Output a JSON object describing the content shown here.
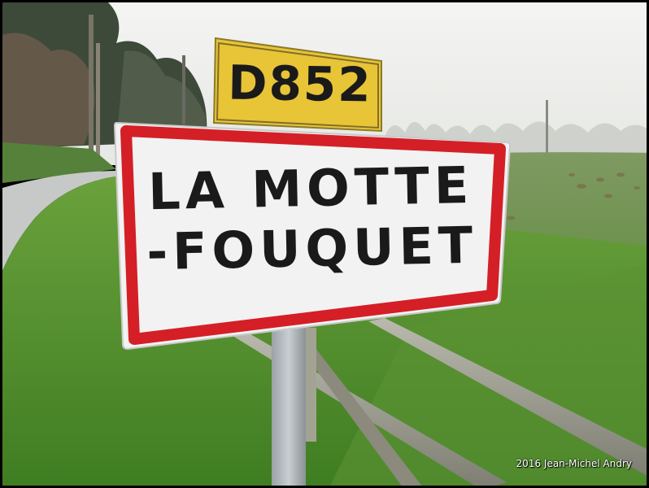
{
  "road_number_plate": {
    "text": "D852",
    "color": "#e8c437"
  },
  "town_sign": {
    "line1": "LA MOTTE",
    "line2": "-FOUQUET",
    "border_color": "#d41f26",
    "background_color": "#f2f2f2"
  },
  "photo_credit": "2016 Jean-Michel Andry"
}
